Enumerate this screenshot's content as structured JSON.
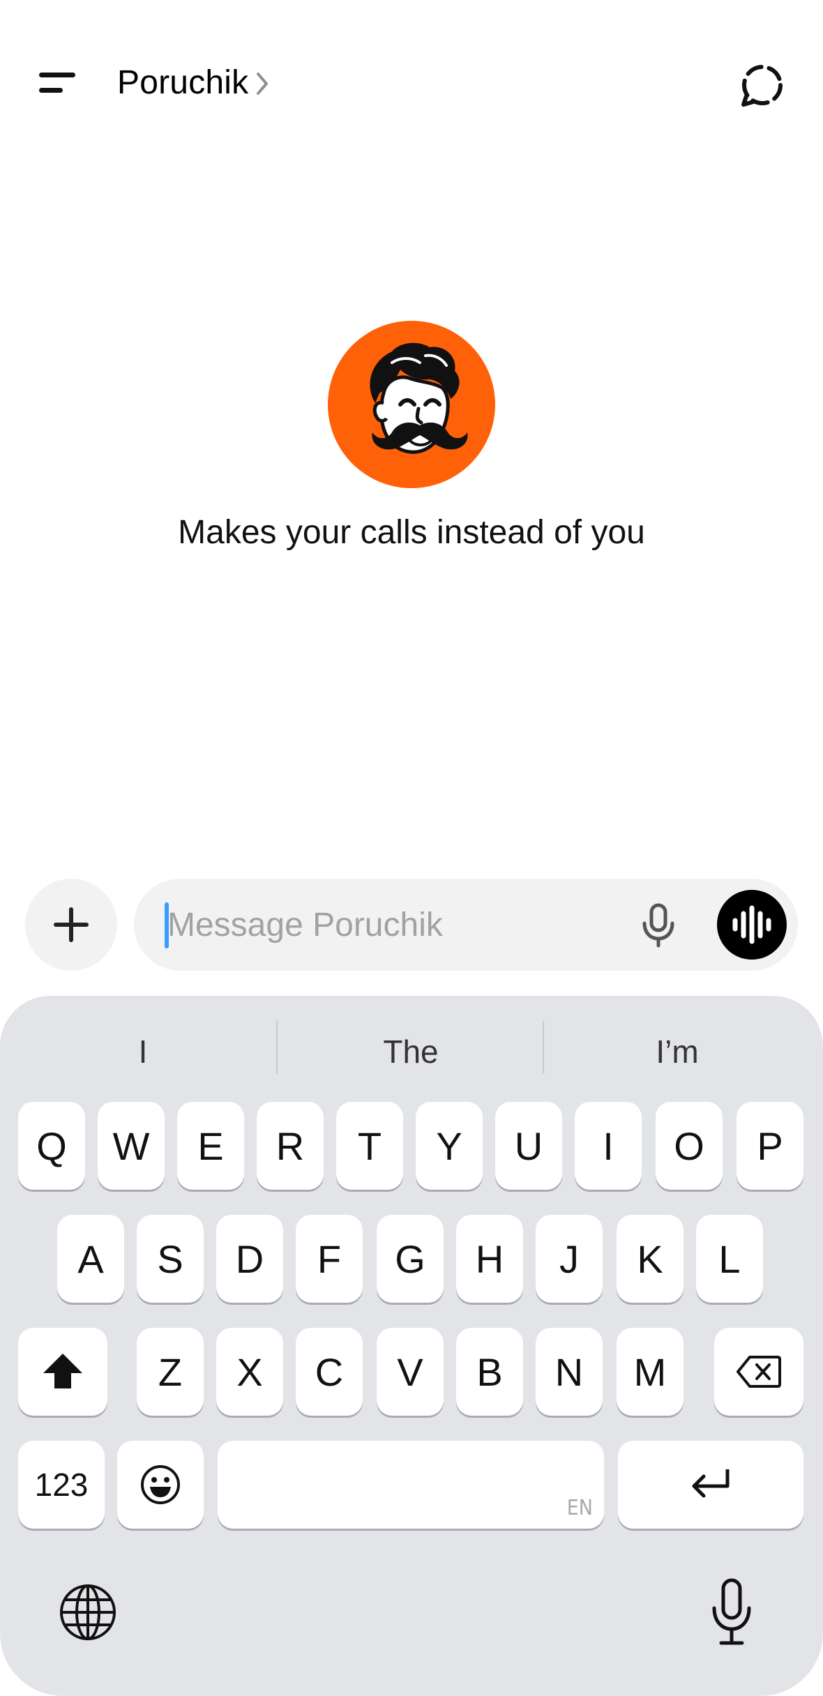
{
  "header": {
    "title": "Poruchik"
  },
  "main": {
    "tagline": "Makes your calls instead of you"
  },
  "composer": {
    "placeholder": "Message Poruchik",
    "value": ""
  },
  "keyboard": {
    "suggestions": [
      "I",
      "The",
      "I’m"
    ],
    "row1": [
      "Q",
      "W",
      "E",
      "R",
      "T",
      "Y",
      "U",
      "I",
      "O",
      "P"
    ],
    "row2": [
      "A",
      "S",
      "D",
      "F",
      "G",
      "H",
      "J",
      "K",
      "L"
    ],
    "row3": [
      "Z",
      "X",
      "C",
      "V",
      "B",
      "N",
      "M"
    ],
    "numbers_label": "123",
    "language_label": "EN"
  },
  "colors": {
    "avatar_bg": "#ff6108",
    "caret": "#3b9cff",
    "keyboard_bg": "#e3e4e7"
  },
  "icons": [
    "menu-icon",
    "chevron-right-icon",
    "new-chat-icon",
    "plus-icon",
    "microphone-icon",
    "voice-waveform-icon",
    "shift-icon",
    "backspace-icon",
    "emoji-icon",
    "return-icon",
    "globe-icon",
    "dictation-icon"
  ]
}
